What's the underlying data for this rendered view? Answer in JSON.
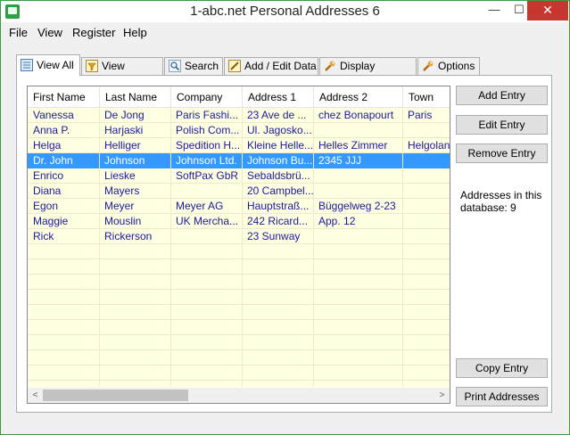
{
  "window": {
    "title": "1-abc.net Personal Addresses 6",
    "controls": {
      "minimize": "—",
      "maximize": "☐",
      "close": "✕"
    }
  },
  "menu": [
    "File",
    "View",
    "Register",
    "Help"
  ],
  "tabs": [
    {
      "label": "View All",
      "icon": "list-icon",
      "active": true
    },
    {
      "label": "View Filtered",
      "icon": "filter-icon",
      "active": false
    },
    {
      "label": "Search",
      "icon": "search-icon",
      "active": false
    },
    {
      "label": "Add / Edit Data",
      "icon": "edit-icon",
      "active": false
    },
    {
      "label": "Display Settings",
      "icon": "wrench-icon",
      "active": false
    },
    {
      "label": "Options",
      "icon": "wrench-icon",
      "active": false
    }
  ],
  "table": {
    "columns": [
      "First Name",
      "Last Name",
      "Company",
      "Address 1",
      "Address 2",
      "Town"
    ],
    "rows": [
      [
        "Vanessa",
        "De Jong",
        "Paris Fashi...",
        "23 Ave de ...",
        "chez Bonapourt",
        "Paris"
      ],
      [
        "Anna P.",
        "Harjaski",
        "Polish Com...",
        "Ul. Jagosko...",
        "",
        ""
      ],
      [
        "Helga",
        "Helliger",
        "Spedition H...",
        "Kleine Helle...",
        "Helles Zimmer",
        "Helgoland"
      ],
      [
        "Dr. John",
        "Johnson",
        "Johnson Ltd.",
        "Johnson Bu...",
        "2345 JJJ",
        ""
      ],
      [
        "Enrico",
        "Lieske",
        "SoftPax GbR",
        "Sebaldsbrü...",
        "",
        ""
      ],
      [
        "Diana",
        "Mayers",
        "",
        "20 Campbel...",
        "",
        ""
      ],
      [
        "Egon",
        "Meyer",
        "Meyer AG",
        "Hauptstraß...",
        "Büggelweg 2-23",
        ""
      ],
      [
        "Maggie",
        "Mouslin",
        "UK Mercha...",
        "242 Ricard...",
        "App. 12",
        ""
      ],
      [
        "Rick",
        "Rickerson",
        "",
        "23 Sunway",
        "",
        ""
      ]
    ],
    "selected_row_index": 3
  },
  "scrollbar": {
    "left_arrow": "<",
    "right_arrow": ">"
  },
  "buttons": {
    "add": "Add Entry",
    "edit": "Edit Entry",
    "remove": "Remove Entry",
    "copy": "Copy Entry",
    "print": "Print Addresses"
  },
  "info_text": "Addresses in this database: 9",
  "colors": {
    "list_background": "#ffffe1",
    "selection": "#3399ff",
    "row_text": "#1a1a9c",
    "close_button": "#c7372f"
  }
}
